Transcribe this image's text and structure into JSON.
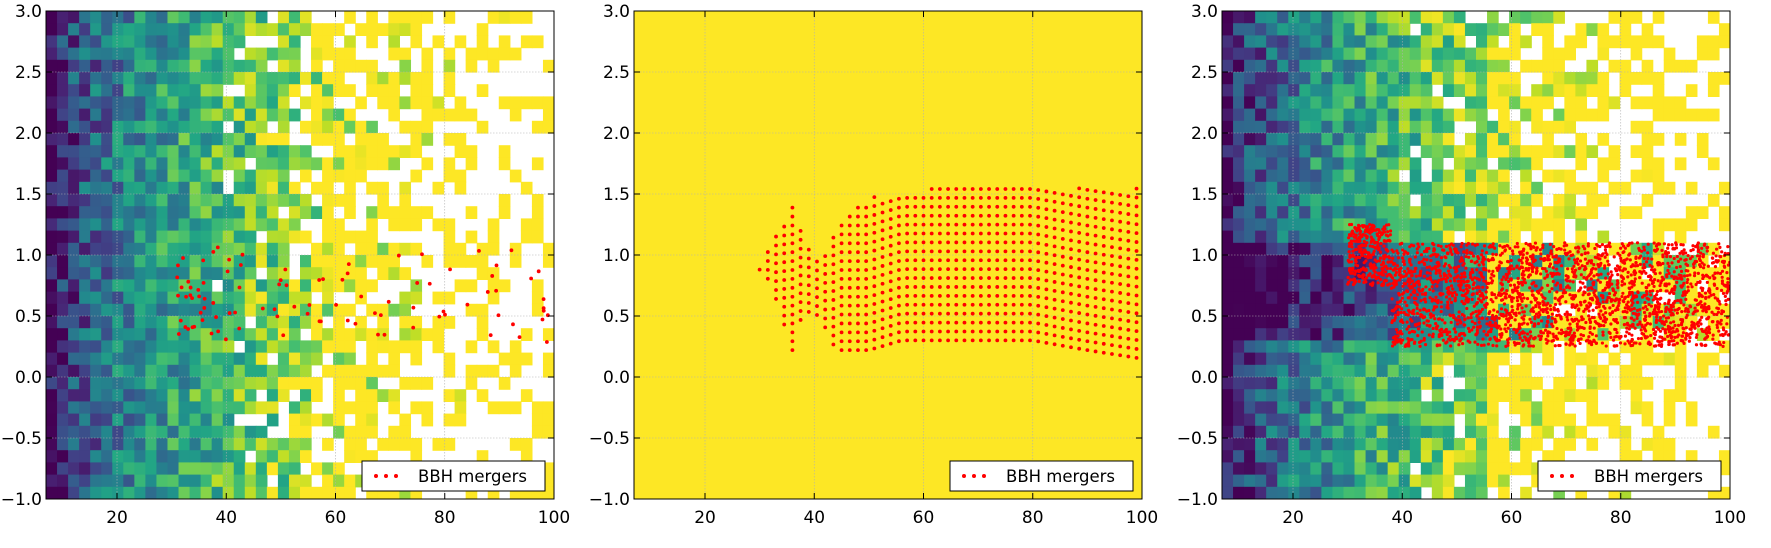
{
  "chart_data": [
    {
      "type": "heatmap",
      "panel": "left",
      "xlim": [
        7,
        100
      ],
      "ylim": [
        -1.0,
        3.0
      ],
      "xticks": [
        20,
        40,
        60,
        80,
        100
      ],
      "yticks": [
        -1.0,
        -0.5,
        0.0,
        0.5,
        1.0,
        1.5,
        2.0,
        2.5,
        3.0
      ],
      "grid": true,
      "legend": {
        "placement": "lower-right",
        "entries": [
          "BBH mergers"
        ]
      },
      "heatmap": {
        "colormap": "viridis",
        "x_bins": 46,
        "y_bins": 40,
        "seed": 11,
        "empty_start": 0.3,
        "empty_slope": 3.4,
        "vary_y": false
      },
      "series": [
        {
          "name": "BBH mergers",
          "style": "scatter",
          "color": "#ff0000",
          "generator": "sparse",
          "count": 95,
          "x_range": [
            31,
            100
          ],
          "y_range": [
            0.28,
            1.08
          ],
          "seed": 5
        }
      ]
    },
    {
      "type": "heatmap",
      "panel": "middle",
      "xlim": [
        7,
        100
      ],
      "ylim": [
        -1.0,
        3.0
      ],
      "xticks": [
        20,
        40,
        60,
        80,
        100
      ],
      "yticks": [
        -1.0,
        -0.5,
        0.0,
        0.5,
        1.0,
        1.5,
        2.0,
        2.5,
        3.0
      ],
      "grid": true,
      "background": "#fde725",
      "legend": {
        "placement": "lower-right",
        "entries": [
          "BBH mergers"
        ]
      },
      "series": [
        {
          "name": "BBH mergers",
          "style": "scatter",
          "color": "#ff0000",
          "generator": "grid",
          "x_start": 30,
          "x_end": 100,
          "x_step": 1.5,
          "y_step": 0.073,
          "envelope": [
            {
              "x": 30,
              "lo": 0.88,
              "hi": 0.88
            },
            {
              "x": 32,
              "lo": 0.78,
              "hi": 1.08
            },
            {
              "x": 36,
              "lo": 0.22,
              "hi": 1.4
            },
            {
              "x": 38,
              "lo": 0.55,
              "hi": 1.2
            },
            {
              "x": 41,
              "lo": 0.5,
              "hi": 0.95
            },
            {
              "x": 44,
              "lo": 0.22,
              "hi": 1.25
            },
            {
              "x": 50,
              "lo": 0.22,
              "hi": 1.47
            },
            {
              "x": 56,
              "lo": 0.3,
              "hi": 1.5
            },
            {
              "x": 62,
              "lo": 0.3,
              "hi": 1.55
            },
            {
              "x": 80,
              "lo": 0.3,
              "hi": 1.55
            },
            {
              "x": 90,
              "lo": 0.22,
              "hi": 1.55
            },
            {
              "x": 100,
              "lo": 0.15,
              "hi": 1.55
            }
          ]
        }
      ]
    },
    {
      "type": "heatmap",
      "panel": "right",
      "xlim": [
        7,
        100
      ],
      "ylim": [
        -1.0,
        3.0
      ],
      "xticks": [
        20,
        40,
        60,
        80,
        100
      ],
      "yticks": [
        -1.0,
        -0.5,
        0.0,
        0.5,
        1.0,
        1.5,
        2.0,
        2.5,
        3.0
      ],
      "grid": true,
      "legend": {
        "placement": "lower-right",
        "entries": [
          "BBH mergers"
        ]
      },
      "heatmap": {
        "colormap": "viridis",
        "x_bins": 46,
        "y_bins": 40,
        "seed": 23,
        "empty_start": 0.3,
        "empty_slope": 2.8,
        "vary_y": true,
        "band_y": [
          0.3,
          1.1
        ]
      },
      "series": [
        {
          "name": "BBH mergers",
          "style": "scatter",
          "color": "#ff0000",
          "generator": "dense",
          "count": 2600,
          "x_range": [
            30,
            100
          ],
          "y_range": [
            0.25,
            1.1
          ],
          "seed": 9
        }
      ]
    }
  ]
}
